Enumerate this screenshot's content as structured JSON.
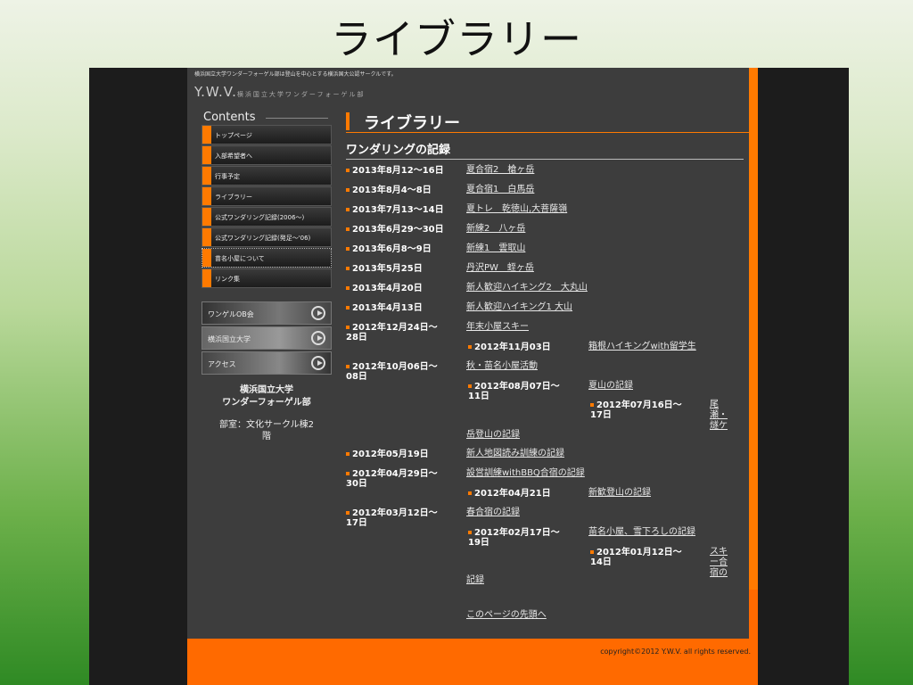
{
  "slide_title": "ライブラリー",
  "site": {
    "tagline": "横浜国立大学ワンダーフォーゲル部は登山を中心とする横浜国大公認サークルです。",
    "logo_main": "Y.W.V.",
    "logo_sub": "横浜国立大学ワンダーフォーゲル部",
    "copyright": "copyright©2012 Y.W.V. all rights reserved."
  },
  "sidebar": {
    "heading": "Contents",
    "items": [
      {
        "label": "トップページ"
      },
      {
        "label": "入部希望者へ"
      },
      {
        "label": "行事予定"
      },
      {
        "label": "ライブラリー"
      },
      {
        "label": "公式ワンダリング記録(2006〜)"
      },
      {
        "label": "公式ワンダリング記録(発足〜'06)"
      },
      {
        "label": "苗名小屋について"
      },
      {
        "label": "リンク集"
      }
    ],
    "banners": [
      {
        "label": "ワンゲルOB会"
      },
      {
        "label": "横浜国立大学"
      },
      {
        "label": "アクセス"
      }
    ],
    "org_line1": "横浜国立大学",
    "org_line2": "ワンダーフォーゲル部",
    "room_line1": "部室：文化サークル棟2",
    "room_line2": "階"
  },
  "main": {
    "title": "ライブラリー",
    "section": "ワンダリングの記録",
    "entries": [
      {
        "date": "2013年8月12〜16日",
        "link": "夏合宿2　槍ヶ岳"
      },
      {
        "date": "2013年8月4〜8日",
        "link": "夏合宿1　白馬岳"
      },
      {
        "date": "2013年7月13〜14日",
        "link": "夏トレ　乾徳山,大菩薩嶺"
      },
      {
        "date": "2013年6月29〜30日",
        "link": "新練2　八ヶ岳"
      },
      {
        "date": "2013年6月8〜9日",
        "link": "新練1　雲取山"
      },
      {
        "date": "2013年5月25日",
        "link": "丹沢PW　蛭ヶ岳"
      },
      {
        "date": "2013年4月20日",
        "link": "新人歓迎ハイキング2　大丸山"
      },
      {
        "date": "2013年4月13日",
        "link": "新人歓迎ハイキング1 大山"
      },
      {
        "date1": "2012年12月24日〜",
        "date2": "28日",
        "link": "年末小屋スキー"
      },
      {
        "date": "2012年11月03日",
        "link": "箱根ハイキングwith留学生"
      },
      {
        "date1": "2012年10月06日〜",
        "date2": "08日",
        "link": "秋・苗名小屋活動"
      },
      {
        "date1": "2012年08月07日〜",
        "date2": "11日",
        "link": "夏山の記録"
      },
      {
        "date1": "2012年07月16日〜",
        "date2": "17日",
        "link_a": "尾",
        "link_b": "瀬・",
        "link_c": "燧ケ",
        "link_d": "岳登山の記録"
      },
      {
        "date": "2012年05月19日",
        "link": "新人地図読み訓練の記録"
      },
      {
        "date1": "2012年04月29日〜",
        "date2": "30日",
        "link": "設営訓練withBBQ合宿の記録"
      },
      {
        "date": "2012年04月21日",
        "link": "新歓登山の記録"
      },
      {
        "date1": "2012年03月12日〜",
        "date2": "17日",
        "link": "春合宿の記録"
      },
      {
        "date1": "2012年02月17日〜",
        "date2": "19日",
        "link": "苗名小屋、雪下ろしの記録"
      },
      {
        "date1": "2012年01月12日〜",
        "date2": "14日",
        "link_a": "スキ",
        "link_b": "ー合",
        "link_c": "宿の",
        "link_d": "記録"
      }
    ],
    "page_top": "このページの先頭へ"
  }
}
